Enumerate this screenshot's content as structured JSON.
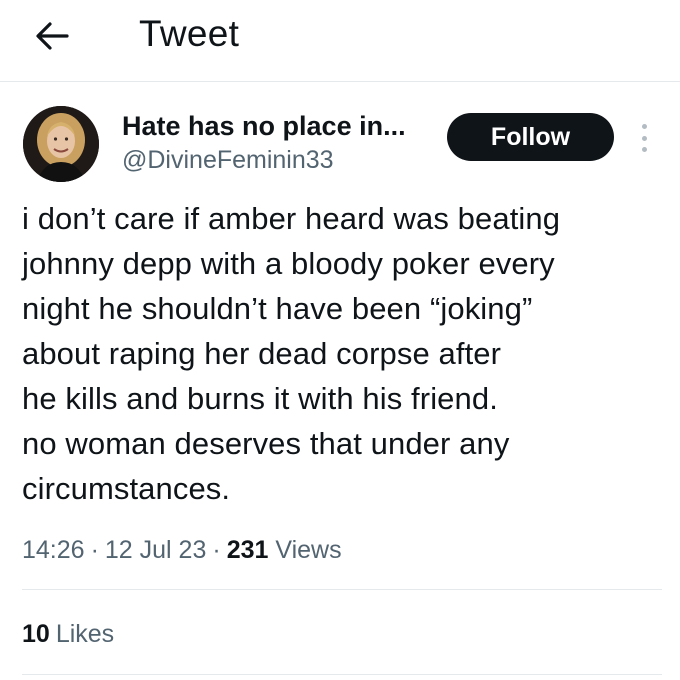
{
  "header": {
    "title": "Tweet",
    "back_icon": "arrow-left-icon"
  },
  "author": {
    "display_name": "Hate has no place in...",
    "handle": "@DivineFeminin33",
    "avatar": "profile-photo"
  },
  "actions": {
    "follow_label": "Follow",
    "more_icon": "more-vertical-icon"
  },
  "tweet": {
    "lines": [
      "i don’t care if amber heard was beating",
      "johnny depp with a bloody poker every",
      "night he shouldn’t have been “joking”",
      "about raping her dead corpse after",
      "he kills and burns it with his friend.",
      "no woman deserves that under any",
      "circumstances."
    ]
  },
  "meta": {
    "time": "14:26",
    "separator": "·",
    "date": "12 Jul 23",
    "views_count": "231",
    "views_label": "Views"
  },
  "stats": {
    "likes_count": "10",
    "likes_label": "Likes"
  },
  "colors": {
    "text": "#0f1419",
    "secondary_text": "#536471",
    "follow_bg": "#0f1419",
    "follow_text": "#ffffff",
    "divider": "#e6e9eb"
  }
}
